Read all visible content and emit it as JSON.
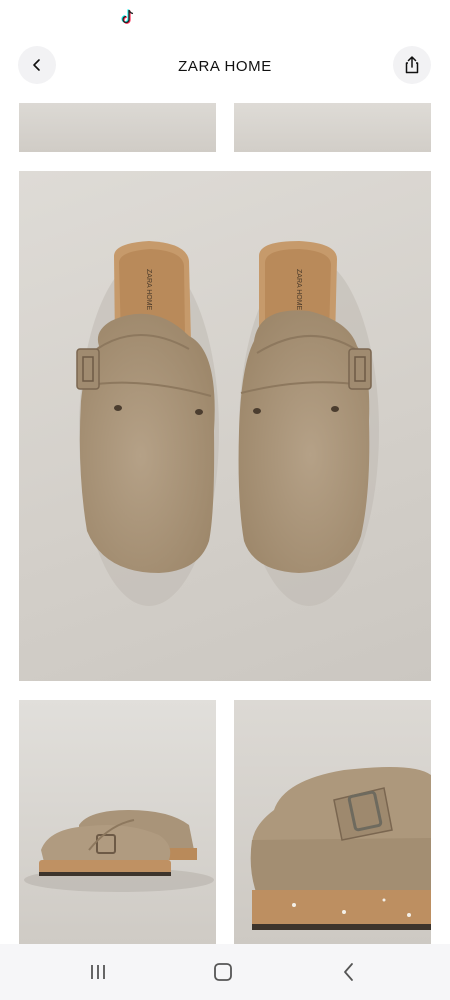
{
  "app": {
    "title": "ZARA HOME"
  },
  "header": {
    "back_icon": "chevron-left-icon",
    "share_icon": "share-icon"
  },
  "gallery": {
    "images": [
      {
        "name": "product-image-1",
        "subject": "clog partial view"
      },
      {
        "name": "product-image-2",
        "subject": "clog partial view"
      },
      {
        "name": "product-image-hero",
        "subject": "pair of suede clogs top view",
        "insole_text": "ZARA HOME"
      },
      {
        "name": "product-image-4",
        "subject": "pair of suede clogs side view"
      },
      {
        "name": "product-image-5",
        "subject": "clog buckle close-up"
      }
    ]
  },
  "system_nav": {
    "recents_icon": "recents-icon",
    "home_icon": "home-icon",
    "back_icon": "back-icon"
  },
  "colors": {
    "suede": "#a99479",
    "cork": "#b98a5a",
    "background": "#d8d5d0"
  }
}
